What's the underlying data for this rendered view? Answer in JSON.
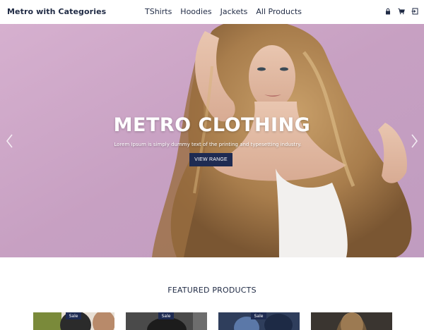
{
  "header": {
    "brand": "Metro with Categories",
    "nav": [
      "TShirts",
      "Hoodies",
      "Jackets",
      "All Products"
    ],
    "icons": [
      "lock-icon",
      "cart-icon",
      "login-icon"
    ]
  },
  "hero": {
    "title": "METRO CLOTHING",
    "subtitle": "Lorem Ipsum is simply dummy text of the printing and typesetting industry.",
    "button": "VIEW RANGE"
  },
  "featured": {
    "title": "FEATURED PRODUCTS",
    "products": [
      {
        "badge": "Sale"
      },
      {
        "badge": "Sale"
      },
      {
        "badge": "Sale"
      },
      {
        "badge": ""
      }
    ]
  },
  "colors": {
    "accent": "#1e2b52",
    "text": "#1f2a44",
    "hero_bg": "#c8a3c3"
  }
}
